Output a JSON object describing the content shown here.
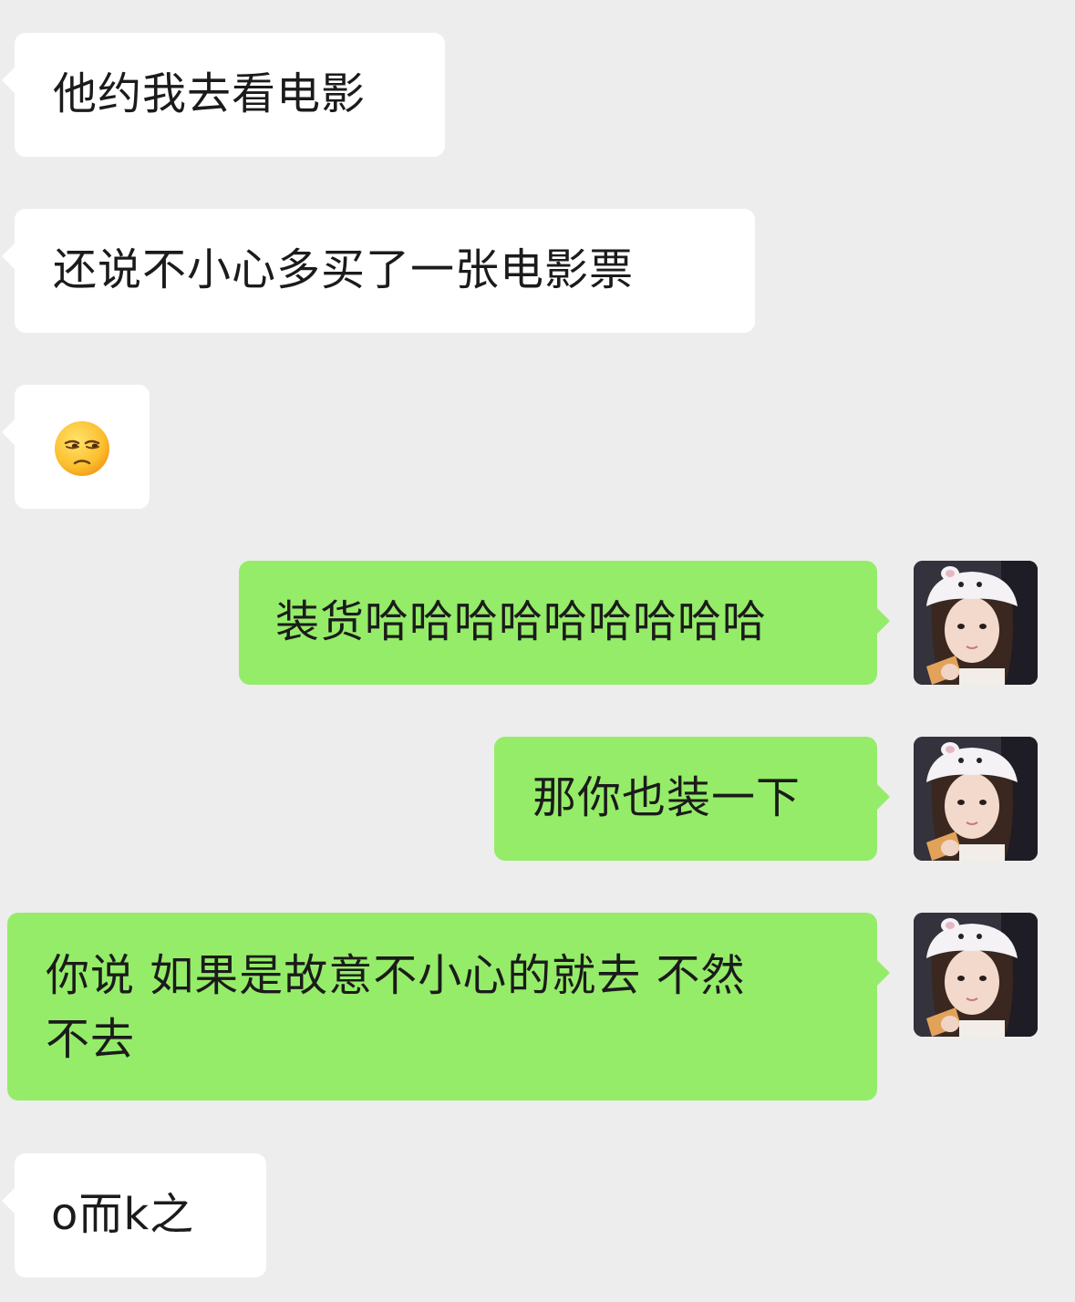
{
  "messages": [
    {
      "side": "left",
      "text": "他约我去看电影"
    },
    {
      "side": "left",
      "text": "还说不小心多买了一张电影票"
    },
    {
      "side": "left",
      "emoji": "unamused-face"
    },
    {
      "side": "right",
      "text": "装货哈哈哈哈哈哈哈哈哈"
    },
    {
      "side": "right",
      "text": "那你也装一下"
    },
    {
      "side": "right",
      "text_line1": "你说 如果是故意不小心的就去 不然",
      "text_line2": "不去"
    },
    {
      "side": "left",
      "text": "o而k之"
    }
  ],
  "avatar": "girl-with-bunny-hat-avatar",
  "colors": {
    "background": "#ededed",
    "incoming_bubble": "#ffffff",
    "outgoing_bubble": "#95ec69",
    "text": "#1b1b1b"
  }
}
